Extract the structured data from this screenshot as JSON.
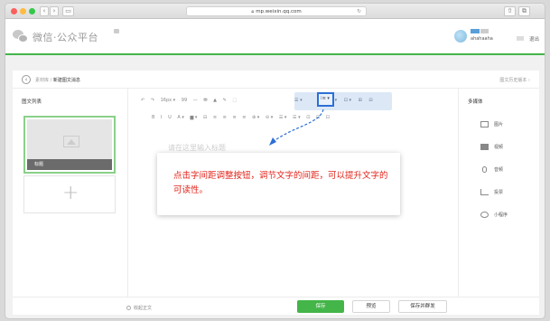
{
  "browser": {
    "url": "mp.weixin.qq.com"
  },
  "header": {
    "logo_text": "微信·公众平台",
    "account_badges": [
      "",
      ""
    ],
    "account_name": "ahahaaha",
    "logout": "退出"
  },
  "breadcrumb": {
    "parent": "素材库",
    "separator": "/",
    "current": "新建图文消息",
    "history": "图文历史版本 ›"
  },
  "left_panel": {
    "title": "图文列表",
    "article_title": "标题",
    "add_symbol": "+"
  },
  "toolbar": {
    "row1": [
      "↶",
      "↷",
      "16px ▾",
      "99",
      "—",
      "⛃",
      "▲",
      "✎",
      "⬚"
    ],
    "row1_blue": [
      "☰ ▾",
      "",
      "☺ ▾",
      "⊡ ▾",
      "⊞",
      "⊟"
    ],
    "row2": [
      "B",
      "I",
      "U",
      "A ▾",
      "▆ ▾",
      "⊟",
      "≡",
      "≡",
      "≡",
      "≡",
      "⊕ ▾",
      "⊖ ▾",
      "☰ ▾",
      "☰ ▾",
      "⊡",
      "⊡",
      "⊡"
    ],
    "spacing_glyph": "⁞≡ ▾"
  },
  "editor": {
    "title_placeholder": "请在这里输入标题"
  },
  "tooltip": {
    "text": "点击字间距调整按钮，调节文字的间距，可以提升文字的可读性。"
  },
  "right_panel": {
    "title": "多媒体",
    "items": [
      {
        "label": "图片",
        "icon": "image-icon"
      },
      {
        "label": "视频",
        "icon": "video-icon"
      },
      {
        "label": "音频",
        "icon": "audio-icon"
      },
      {
        "label": "投票",
        "icon": "vote-icon"
      },
      {
        "label": "小程序",
        "icon": "miniprogram-icon"
      }
    ]
  },
  "bottom": {
    "collapse": "收起正文",
    "save": "保存",
    "preview": "预览",
    "save_send": "保存并群发"
  },
  "colors": {
    "brand_green": "#44b549",
    "highlight_blue": "#2c6fd6",
    "tooltip_red": "#e2231a"
  }
}
